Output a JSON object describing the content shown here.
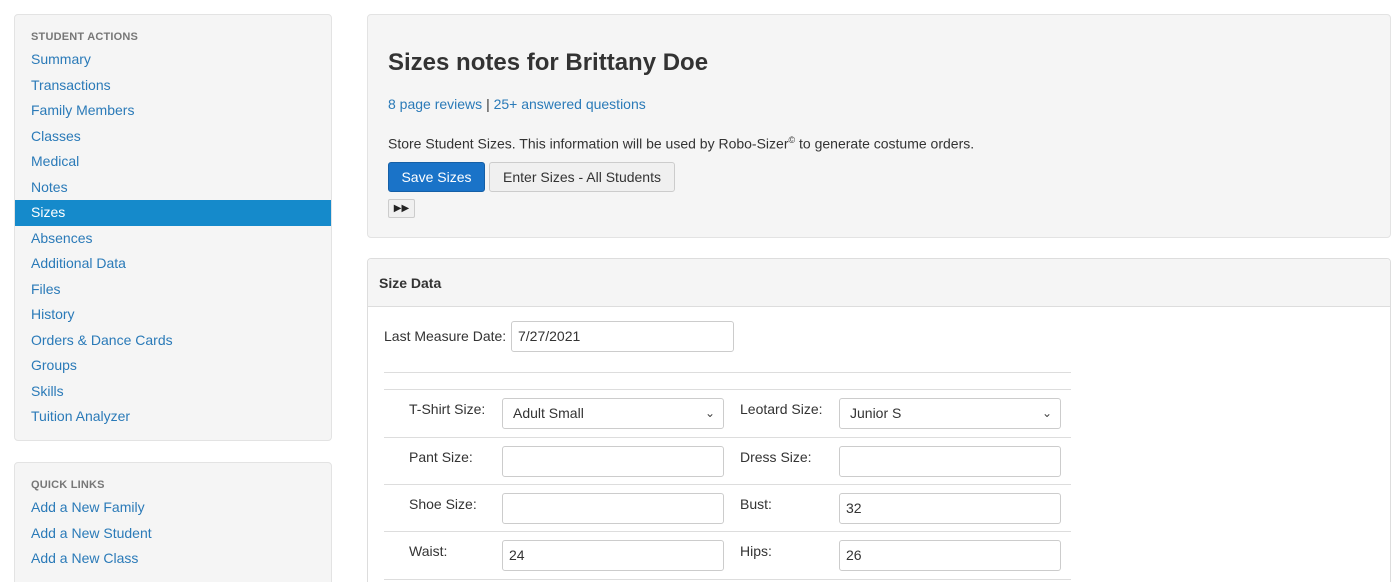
{
  "sidebar": {
    "actions_header": "STUDENT ACTIONS",
    "actions": [
      {
        "label": "Summary"
      },
      {
        "label": "Transactions"
      },
      {
        "label": "Family Members"
      },
      {
        "label": "Classes"
      },
      {
        "label": "Medical"
      },
      {
        "label": "Notes"
      },
      {
        "label": "Sizes",
        "active": true
      },
      {
        "label": "Absences"
      },
      {
        "label": "Additional Data"
      },
      {
        "label": "Files"
      },
      {
        "label": "History"
      },
      {
        "label": "Orders & Dance Cards"
      },
      {
        "label": "Groups"
      },
      {
        "label": "Skills"
      },
      {
        "label": "Tuition Analyzer"
      }
    ],
    "links_header": "QUICK LINKS",
    "links": [
      {
        "label": "Add a New Family"
      },
      {
        "label": "Add a New Student"
      },
      {
        "label": "Add a New Class"
      }
    ]
  },
  "header": {
    "title": "Sizes notes for Brittany Doe",
    "reviews_link": "8 page reviews",
    "separator": "|",
    "questions_link": "25+ answered questions",
    "description_pre": "Store Student Sizes. This information will be used by Robo-Sizer",
    "description_sup": "©",
    "description_post": " to generate costume orders.",
    "save_button": "Save Sizes",
    "enter_all_button": "Enter Sizes - All Students",
    "forward_icon": "fast-forward-icon"
  },
  "size_data": {
    "panel_title": "Size Data",
    "last_measure_label": "Last Measure Date:",
    "last_measure_value": "7/27/2021",
    "fields": {
      "tshirt_label": "T-Shirt Size:",
      "tshirt_value": "Adult Small",
      "leotard_label": "Leotard Size:",
      "leotard_value": "Junior S",
      "pant_label": "Pant Size:",
      "pant_value": "",
      "dress_label": "Dress Size:",
      "dress_value": "",
      "shoe_label": "Shoe Size:",
      "shoe_value": "",
      "bust_label": "Bust:",
      "bust_value": "32",
      "waist_label": "Waist:",
      "waist_value": "24",
      "hips_label": "Hips:",
      "hips_value": "26"
    }
  },
  "colors": {
    "link": "#2a7ab8",
    "active_nav": "#158acb",
    "primary_button": "#1a73c8"
  }
}
